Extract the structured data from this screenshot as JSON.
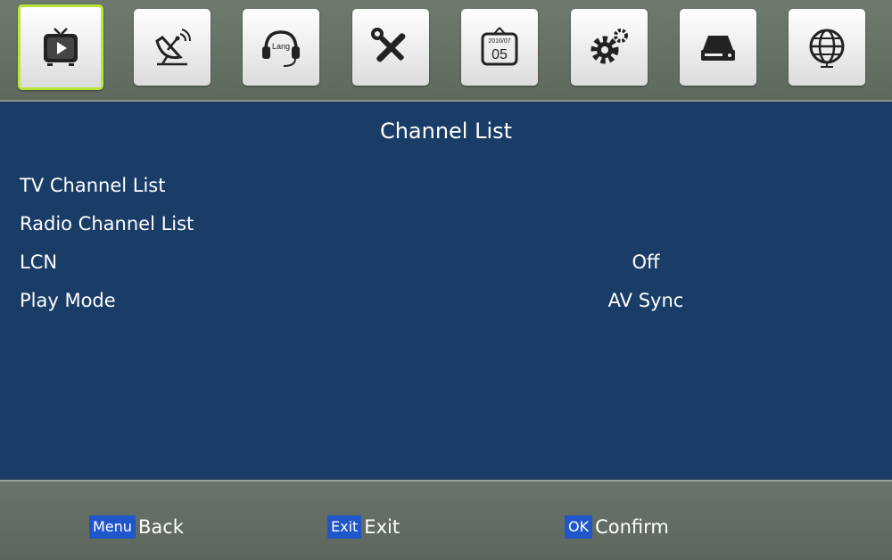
{
  "top_tabs": [
    {
      "icon": "tv-icon",
      "selected": true
    },
    {
      "icon": "satellite-dish-icon",
      "selected": false
    },
    {
      "icon": "language-headset-icon",
      "label": "Lang",
      "selected": false
    },
    {
      "icon": "tools-icon",
      "selected": false
    },
    {
      "icon": "calendar-icon",
      "date_top": "2016/07",
      "date_day": "05",
      "selected": false
    },
    {
      "icon": "gears-icon",
      "selected": false
    },
    {
      "icon": "storage-drive-icon",
      "selected": false
    },
    {
      "icon": "globe-icon",
      "selected": false
    }
  ],
  "page": {
    "title": "Channel List"
  },
  "menu_items": [
    {
      "label": "TV Channel List",
      "value": ""
    },
    {
      "label": "Radio Channel List",
      "value": ""
    },
    {
      "label": "LCN",
      "value": "Off"
    },
    {
      "label": "Play Mode",
      "value": "AV Sync"
    }
  ],
  "footer": {
    "back": {
      "key": "Menu",
      "label": "Back"
    },
    "exit": {
      "key": "Exit",
      "label": "Exit"
    },
    "confirm": {
      "key": "OK",
      "label": "Confirm"
    }
  },
  "colors": {
    "panel": "#1a3d68",
    "bar": "#66706a",
    "selected_border": "#b8e63a",
    "key_bg": "#1f56c9"
  }
}
